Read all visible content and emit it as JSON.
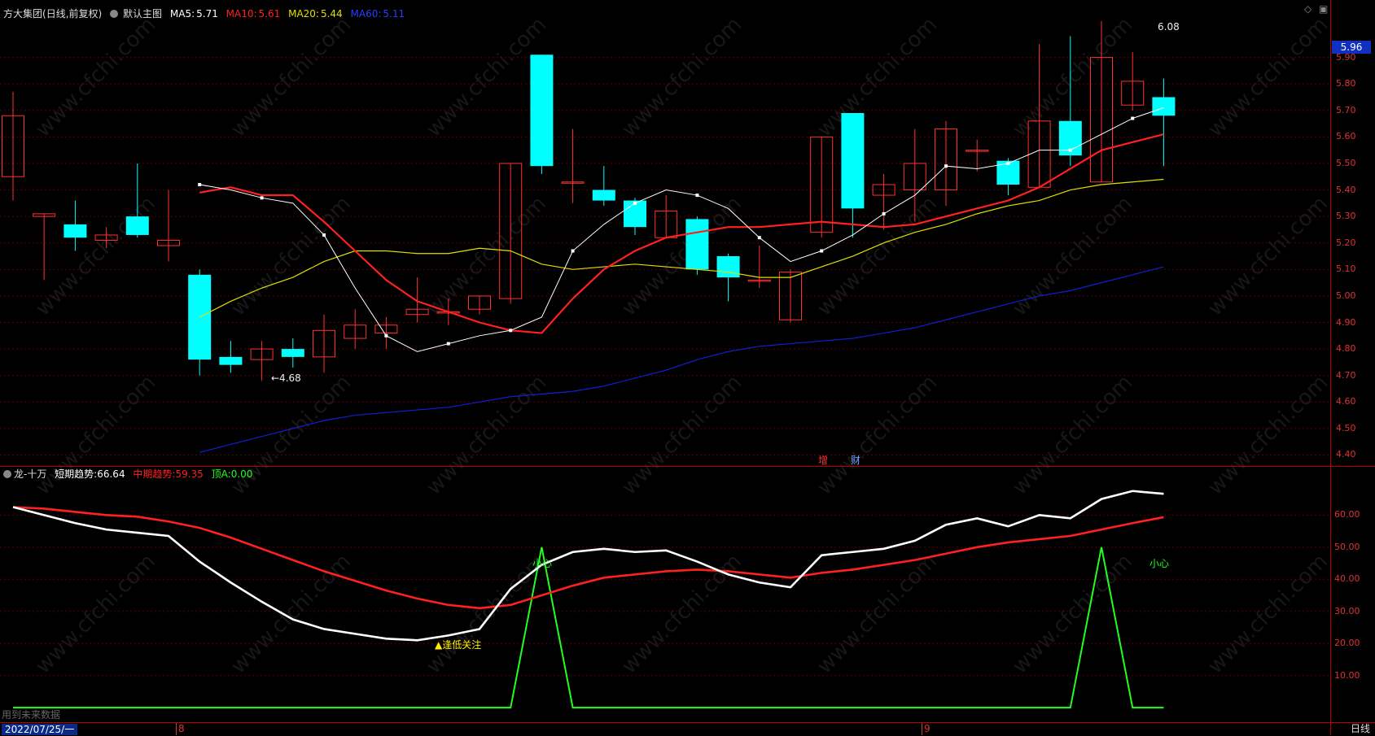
{
  "header": {
    "stock_name": "方大集团",
    "adjust_mode": "(日线,前复权)",
    "chart_name": "默认主图",
    "ma5_label": "MA5:",
    "ma5_value": "5.71",
    "ma10_label": "MA10:",
    "ma10_value": "5.61",
    "ma20_label": "MA20:",
    "ma20_value": "5.44",
    "ma60_label": "MA60:",
    "ma60_value": "5.11"
  },
  "sub_header": {
    "indicator_name": "龙-十万",
    "short_label": "短期趋势:",
    "short_value": "66.64",
    "mid_label": "中期趋势:",
    "mid_value": "59.35",
    "top_label": "顶A:",
    "top_value": "0.00"
  },
  "annotations": {
    "high_label": "6.08",
    "low_label": "←4.68",
    "current_price": "5.96",
    "bottom_focus": "逢低关注",
    "caution_1": "小心",
    "caution_2": "小心",
    "tag_add": "增",
    "tag_cai": "财",
    "future_data_note": "用到未来数据",
    "watermark": "www.cfchi.com"
  },
  "footer": {
    "date": "2022/07/25/一",
    "month_8": "8",
    "month_9": "9",
    "period": "日线"
  },
  "colors": {
    "up": "#ff3030",
    "down": "#00ffff",
    "ma5": "#ffffff",
    "ma10": "#ff2020",
    "ma20": "#e0e000",
    "ma60": "#1020d0",
    "short_trend": "#ffffff",
    "mid_trend": "#ff2020",
    "top_a": "#20ff20"
  },
  "price_axis": [
    "5.90",
    "5.80",
    "5.70",
    "5.60",
    "5.50",
    "5.40",
    "5.30",
    "5.20",
    "5.10",
    "5.00",
    "4.90",
    "4.80",
    "4.70",
    "4.60",
    "4.50",
    "4.40"
  ],
  "indicator_axis": [
    "60.00",
    "50.00",
    "40.00",
    "30.00",
    "20.00",
    "10.00"
  ],
  "chart_data": {
    "type": "candlestick",
    "candles": [
      {
        "o": 5.45,
        "h": 5.77,
        "l": 5.36,
        "c": 5.68
      },
      {
        "o": 5.3,
        "h": 5.31,
        "l": 5.06,
        "c": 5.31
      },
      {
        "o": 5.27,
        "h": 5.36,
        "l": 5.17,
        "c": 5.22
      },
      {
        "o": 5.21,
        "h": 5.26,
        "l": 5.18,
        "c": 5.23
      },
      {
        "o": 5.3,
        "h": 5.5,
        "l": 5.22,
        "c": 5.23
      },
      {
        "o": 5.19,
        "h": 5.4,
        "l": 5.13,
        "c": 5.21
      },
      {
        "o": 5.08,
        "h": 5.1,
        "l": 4.7,
        "c": 4.76
      },
      {
        "o": 4.77,
        "h": 4.83,
        "l": 4.71,
        "c": 4.74
      },
      {
        "o": 4.76,
        "h": 4.83,
        "l": 4.68,
        "c": 4.8
      },
      {
        "o": 4.8,
        "h": 4.84,
        "l": 4.73,
        "c": 4.77
      },
      {
        "o": 4.77,
        "h": 4.93,
        "l": 4.71,
        "c": 4.87
      },
      {
        "o": 4.84,
        "h": 4.95,
        "l": 4.8,
        "c": 4.89
      },
      {
        "o": 4.86,
        "h": 4.92,
        "l": 4.8,
        "c": 4.89
      },
      {
        "o": 4.93,
        "h": 5.07,
        "l": 4.9,
        "c": 4.95
      },
      {
        "o": 4.94,
        "h": 4.99,
        "l": 4.89,
        "c": 4.94
      },
      {
        "o": 4.95,
        "h": 5.0,
        "l": 4.93,
        "c": 5.0
      },
      {
        "o": 4.99,
        "h": 5.5,
        "l": 4.97,
        "c": 5.5
      },
      {
        "o": 5.91,
        "h": 5.91,
        "l": 5.46,
        "c": 5.49
      },
      {
        "o": 5.43,
        "h": 5.63,
        "l": 5.35,
        "c": 5.43
      },
      {
        "o": 5.4,
        "h": 5.49,
        "l": 5.34,
        "c": 5.36
      },
      {
        "o": 5.36,
        "h": 5.37,
        "l": 5.23,
        "c": 5.26
      },
      {
        "o": 5.22,
        "h": 5.38,
        "l": 5.22,
        "c": 5.32
      },
      {
        "o": 5.29,
        "h": 5.3,
        "l": 5.08,
        "c": 5.1
      },
      {
        "o": 5.15,
        "h": 5.16,
        "l": 4.98,
        "c": 5.07
      },
      {
        "o": 5.06,
        "h": 5.19,
        "l": 5.03,
        "c": 5.06
      },
      {
        "o": 4.91,
        "h": 5.1,
        "l": 4.9,
        "c": 5.09
      },
      {
        "o": 5.24,
        "h": 5.6,
        "l": 5.22,
        "c": 5.6
      },
      {
        "o": 5.69,
        "h": 5.69,
        "l": 5.22,
        "c": 5.33
      },
      {
        "o": 5.38,
        "h": 5.46,
        "l": 5.25,
        "c": 5.42
      },
      {
        "o": 5.4,
        "h": 5.63,
        "l": 5.28,
        "c": 5.5
      },
      {
        "o": 5.4,
        "h": 5.66,
        "l": 5.34,
        "c": 5.63
      },
      {
        "o": 5.55,
        "h": 5.59,
        "l": 5.47,
        "c": 5.55
      },
      {
        "o": 5.51,
        "h": 5.52,
        "l": 5.38,
        "c": 5.42
      },
      {
        "o": 5.41,
        "h": 5.95,
        "l": 5.41,
        "c": 5.66
      },
      {
        "o": 5.66,
        "h": 5.98,
        "l": 5.49,
        "c": 5.53
      },
      {
        "o": 5.43,
        "h": 6.08,
        "l": 5.43,
        "c": 5.9
      },
      {
        "o": 5.72,
        "h": 5.92,
        "l": 5.7,
        "c": 5.81
      },
      {
        "o": 5.75,
        "h": 5.82,
        "l": 5.49,
        "c": 5.68
      }
    ],
    "ma5": [
      5.42,
      5.4,
      5.37,
      5.35,
      5.23,
      5.03,
      4.85,
      4.79,
      4.82,
      4.85,
      4.87,
      4.92,
      5.17,
      5.27,
      5.35,
      5.4,
      5.38,
      5.33,
      5.22,
      5.13,
      5.17,
      5.23,
      5.31,
      5.38,
      5.49,
      5.48,
      5.5,
      5.55,
      5.55,
      5.61,
      5.67,
      5.71
    ],
    "ma10": [
      5.39,
      5.41,
      5.38,
      5.38,
      5.28,
      5.17,
      5.06,
      4.98,
      4.94,
      4.9,
      4.87,
      4.86,
      4.99,
      5.1,
      5.17,
      5.22,
      5.24,
      5.26,
      5.26,
      5.27,
      5.28,
      5.27,
      5.26,
      5.27,
      5.3,
      5.33,
      5.36,
      5.41,
      5.48,
      5.55,
      5.58,
      5.61
    ],
    "ma20": [
      4.92,
      4.98,
      5.03,
      5.07,
      5.13,
      5.17,
      5.17,
      5.16,
      5.16,
      5.18,
      5.17,
      5.12,
      5.1,
      5.11,
      5.12,
      5.11,
      5.1,
      5.09,
      5.07,
      5.07,
      5.11,
      5.15,
      5.2,
      5.24,
      5.27,
      5.31,
      5.34,
      5.36,
      5.4,
      5.42,
      5.43,
      5.44
    ],
    "ma60": [
      4.41,
      4.44,
      4.47,
      4.5,
      4.53,
      4.55,
      4.56,
      4.57,
      4.58,
      4.6,
      4.62,
      4.63,
      4.64,
      4.66,
      4.69,
      4.72,
      4.76,
      4.79,
      4.81,
      4.82,
      4.83,
      4.84,
      4.86,
      4.88,
      4.91,
      4.94,
      4.97,
      5.0,
      5.02,
      5.05,
      5.08,
      5.11
    ],
    "short_trend": [
      62.5,
      60.0,
      57.5,
      55.5,
      54.5,
      53.5,
      45.5,
      39.0,
      33.0,
      27.5,
      24.5,
      23.0,
      21.5,
      21.0,
      22.5,
      24.5,
      37.0,
      44.5,
      48.5,
      49.5,
      48.5,
      49.0,
      45.5,
      41.5,
      39.0,
      37.5,
      47.5,
      48.5,
      49.5,
      52.0,
      57.0,
      59.0,
      56.5,
      60.0,
      59.0,
      65.0,
      67.5,
      66.64
    ],
    "mid_trend": [
      62.5,
      62.0,
      61.0,
      60.0,
      59.5,
      58.0,
      56.0,
      53.0,
      49.5,
      46.0,
      42.5,
      39.5,
      36.5,
      34.0,
      32.0,
      31.0,
      32.0,
      35.0,
      38.0,
      40.5,
      41.5,
      42.5,
      43.0,
      42.5,
      41.5,
      40.5,
      42.0,
      43.0,
      44.5,
      46.0,
      48.0,
      50.0,
      51.5,
      52.5,
      53.5,
      55.5,
      57.5,
      59.35
    ],
    "top_a": [
      0,
      0,
      0,
      0,
      0,
      0,
      0,
      0,
      0,
      0,
      0,
      0,
      0,
      0,
      0,
      0,
      0,
      50,
      0,
      0,
      0,
      0,
      0,
      0,
      0,
      0,
      0,
      0,
      0,
      0,
      0,
      0,
      0,
      0,
      0,
      50,
      0,
      0
    ]
  }
}
